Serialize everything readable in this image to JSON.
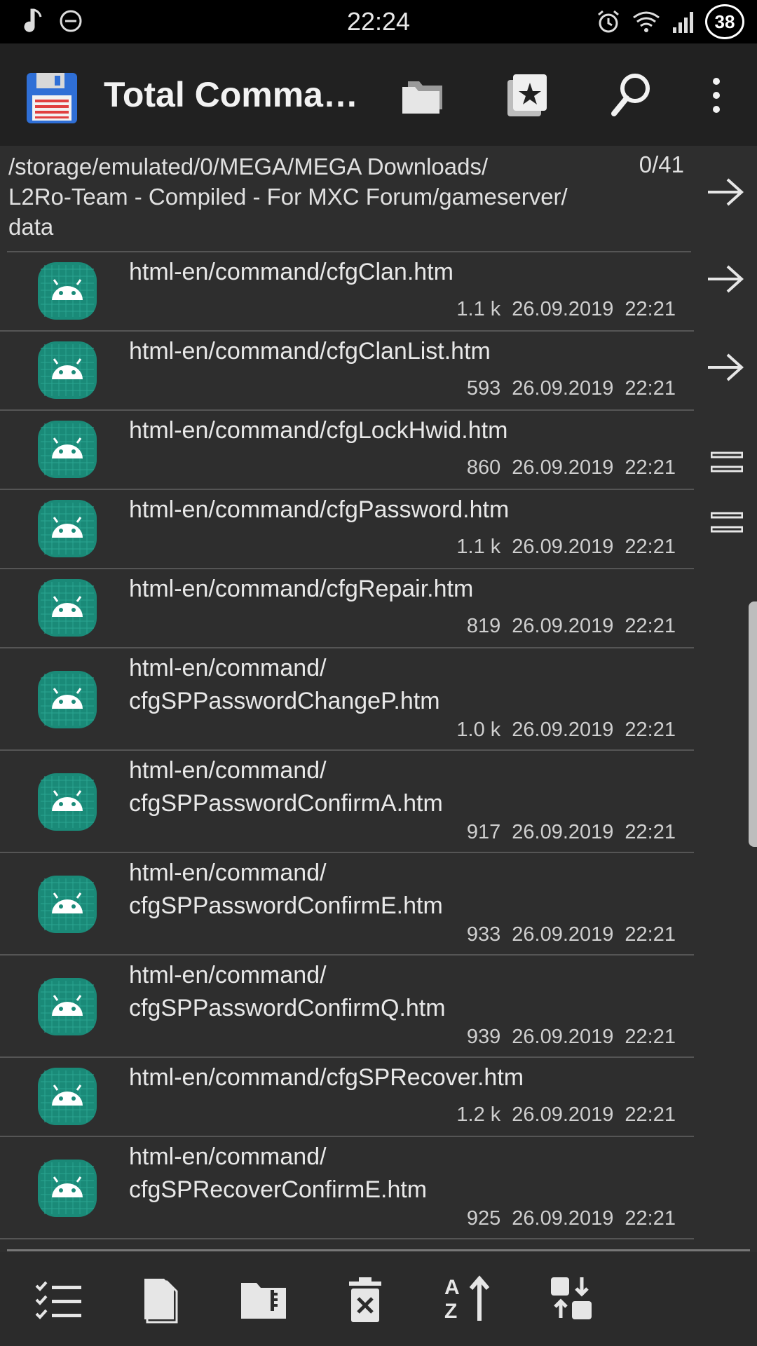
{
  "status_bar": {
    "time": "22:24",
    "battery": "38"
  },
  "app_bar": {
    "title": "Total Comman…"
  },
  "path": {
    "text": "/storage/emulated/0/MEGA/MEGA Downloads/\nL2Ro-Team - Compiled - For MXC Forum/gameserver/\ndata",
    "count": "0/41"
  },
  "files": [
    {
      "name_line1": "html-en/command/cfgClan.htm",
      "name_line2": "",
      "size": "1.1 k",
      "date": "26.09.2019",
      "time": "22:21"
    },
    {
      "name_line1": "html-en/command/cfgClanList.htm",
      "name_line2": "",
      "size": "593",
      "date": "26.09.2019",
      "time": "22:21"
    },
    {
      "name_line1": "html-en/command/cfgLockHwid.htm",
      "name_line2": "",
      "size": "860",
      "date": "26.09.2019",
      "time": "22:21"
    },
    {
      "name_line1": "html-en/command/cfgPassword.htm",
      "name_line2": "",
      "size": "1.1 k",
      "date": "26.09.2019",
      "time": "22:21"
    },
    {
      "name_line1": "html-en/command/cfgRepair.htm",
      "name_line2": "",
      "size": "819",
      "date": "26.09.2019",
      "time": "22:21"
    },
    {
      "name_line1": "html-en/command/",
      "name_line2": "cfgSPPasswordChangeP.htm",
      "size": "1.0 k",
      "date": "26.09.2019",
      "time": "22:21"
    },
    {
      "name_line1": "html-en/command/",
      "name_line2": "cfgSPPasswordConfirmA.htm",
      "size": "917",
      "date": "26.09.2019",
      "time": "22:21"
    },
    {
      "name_line1": "html-en/command/",
      "name_line2": "cfgSPPasswordConfirmE.htm",
      "size": "933",
      "date": "26.09.2019",
      "time": "22:21"
    },
    {
      "name_line1": "html-en/command/",
      "name_line2": "cfgSPPasswordConfirmQ.htm",
      "size": "939",
      "date": "26.09.2019",
      "time": "22:21"
    },
    {
      "name_line1": "html-en/command/cfgSPRecover.htm",
      "name_line2": "",
      "size": "1.2 k",
      "date": "26.09.2019",
      "time": "22:21"
    },
    {
      "name_line1": "html-en/command/",
      "name_line2": "cfgSPRecoverConfirmE.htm",
      "size": "925",
      "date": "26.09.2019",
      "time": "22:21"
    }
  ],
  "colors": {
    "android_icon": "#1a8a78",
    "background": "#2e2e2e",
    "app_bar": "#212121"
  },
  "icons": {
    "app": "floppy-disk-icon",
    "folders": "folders-icon",
    "bookmarks": "bookmark-star-icon",
    "search": "search-icon",
    "menu": "more-vert-icon",
    "bottom": [
      "select-list-icon",
      "new-file-icon",
      "zip-folder-icon",
      "delete-icon",
      "sort-az-icon",
      "swap-icon"
    ]
  }
}
